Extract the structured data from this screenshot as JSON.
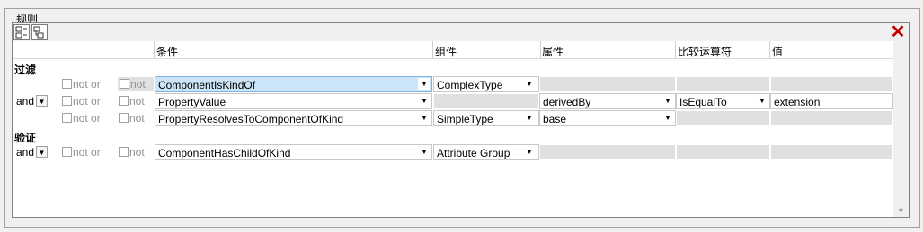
{
  "group_title": "规则",
  "columns": {
    "condition": "条件",
    "component": "组件",
    "attribute": "属性",
    "operator": "比较运算符",
    "value": "值"
  },
  "sections": {
    "filter": "过滤",
    "validation": "验证"
  },
  "labels": {
    "not_or": "not or",
    "not": "not"
  },
  "rows": [
    {
      "and": "",
      "condition": "ComponentIsKindOf",
      "component": "ComplexType",
      "attribute": "",
      "operator": "",
      "value": ""
    },
    {
      "and": "and",
      "condition": "PropertyValue",
      "component": "",
      "attribute": "derivedBy",
      "operator": "IsEqualTo",
      "value": "extension"
    },
    {
      "and": "",
      "condition": "PropertyResolvesToComponentOfKind",
      "component": "SimpleType",
      "attribute": "base",
      "operator": "",
      "value": ""
    },
    {
      "and": "and",
      "condition": "ComponentHasChildOfKind",
      "component": "Attribute Group",
      "attribute": "",
      "operator": "",
      "value": ""
    }
  ],
  "icons": {
    "toolbar_left": "insert-rule-icon",
    "toolbar_right": "append-rule-icon",
    "close": "close-icon"
  },
  "colors": {
    "close": "#c00000",
    "selection": "#cce4f7",
    "disabled_cell": "#e0e0e0"
  }
}
